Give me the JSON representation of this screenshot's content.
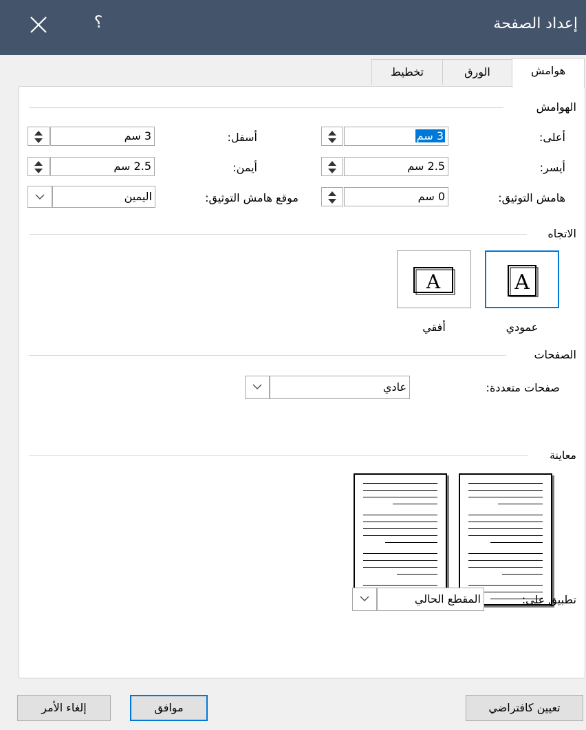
{
  "dialog": {
    "title": "إعداد الصفحة",
    "help": "؟"
  },
  "tabs": [
    {
      "label": "هوامش",
      "active": true
    },
    {
      "label": "الورق",
      "active": false
    },
    {
      "label": "تخطيط",
      "active": false
    }
  ],
  "margins": {
    "heading": "الهوامش",
    "top": {
      "label": "أعلى:",
      "value": "3 سم"
    },
    "bottom": {
      "label": "أسفل:",
      "value": "3 سم"
    },
    "left": {
      "label": "أيسر:",
      "value": "2.5 سم"
    },
    "right": {
      "label": "أيمن:",
      "value": "2.5 سم"
    },
    "gutter": {
      "label": "هامش التوثيق:",
      "value": "0 سم"
    },
    "gutter_position": {
      "label": "موقع هامش التوثيق:",
      "value": "اليمين"
    }
  },
  "orientation": {
    "heading": "الاتجاه",
    "portrait": {
      "label": "عمودي",
      "selected": true
    },
    "landscape": {
      "label": "أفقي",
      "selected": false
    },
    "icon_letter": "A"
  },
  "pages": {
    "heading": "الصفحات",
    "multiple_pages": {
      "label": "صفحات متعددة:",
      "value": "عادي"
    }
  },
  "preview": {
    "heading": "معاينة",
    "apply_to": {
      "label": "تطبيق على:",
      "value": "المقطع الحالي"
    }
  },
  "buttons": {
    "set_default": "تعيين كافتراضي",
    "ok": "موافق",
    "cancel": "إلغاء الأمر"
  },
  "colors": {
    "titlebar": "#44546a",
    "accent": "#0078d7",
    "dialog_bg": "#f0f0f0"
  }
}
